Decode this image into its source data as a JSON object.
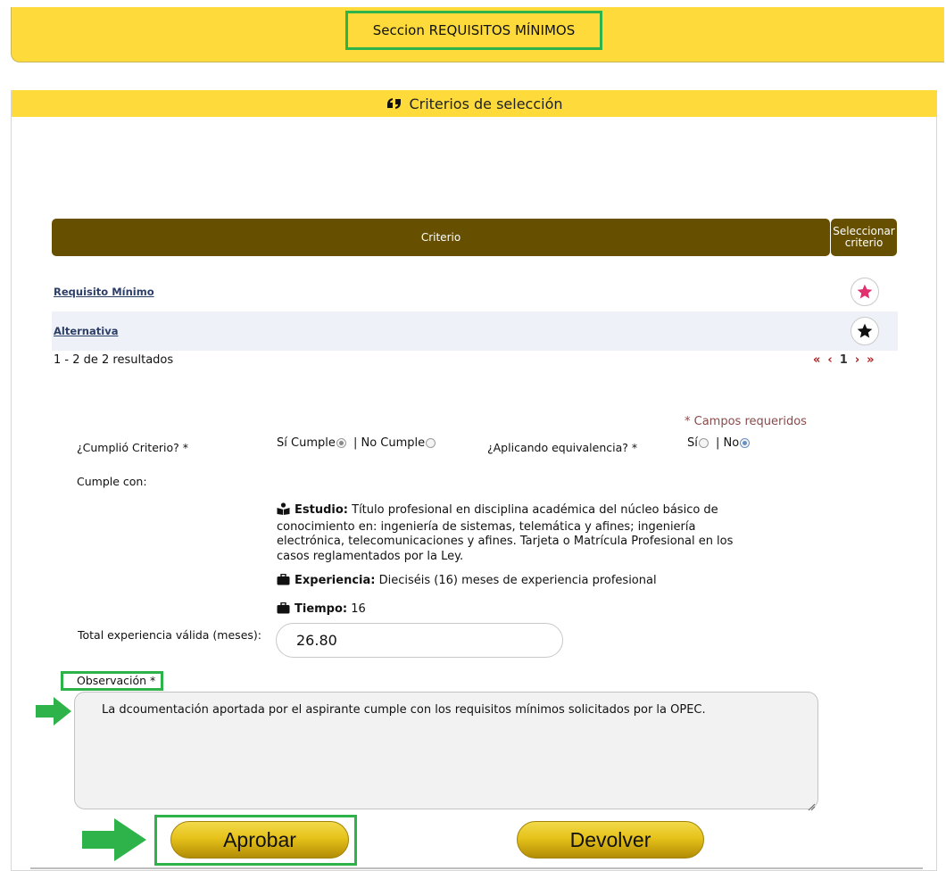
{
  "section": {
    "title": "Seccion REQUISITOS MÍNIMOS"
  },
  "criteria_panel": {
    "title": "Criterios de selección",
    "title_icon": "quote-icon"
  },
  "table": {
    "headers": [
      "Criterio",
      "Seleccionar criterio"
    ],
    "rows": [
      {
        "label": "Requisito Mínimo",
        "star_color": "#e0306e",
        "star_icon": "star-icon"
      },
      {
        "label": "Alternativa",
        "star_color": "#111111",
        "star_icon": "star-icon"
      }
    ],
    "results": "1 - 2 de 2 resultados",
    "pager": {
      "first": "«",
      "prev": "‹",
      "page": "1",
      "next": "›",
      "last": "»"
    }
  },
  "form": {
    "required_note": "* Campos requeridos",
    "cumplio_label": "¿Cumplió Criterio? *",
    "si_cumple": "Sí Cumple",
    "no_cumple": "No Cumple",
    "aplicando_label": "¿Aplicando equivalencia? *",
    "si": "Sí",
    "no": "No",
    "cumple_con_label": "Cumple con:",
    "estudio_title": "Estudio:",
    "estudio_text": "Título profesional en disciplina académica del núcleo básico de conocimiento en: ingeniería de sistemas, telemática y afines; ingeniería electrónica, telecomunicaciones y afines. Tarjeta o Matrícula Profesional en los casos reglamentados por la Ley.",
    "experiencia_title": "Experiencia:",
    "experiencia_text": "Dieciséis (16) meses de experiencia profesional",
    "tiempo_title": "Tiempo:",
    "tiempo_value": "16",
    "total_label": "Total experiencia válida (meses):",
    "total_value": "26.80",
    "observacion_label": "Observación *",
    "observacion_text": "La dcoumentación aportada por el aspirante cumple con los requisitos mínimos solicitados por la OPEC."
  },
  "buttons": {
    "aprobar": "Aprobar",
    "devolver": "Devolver"
  },
  "colors": {
    "header_yellow": "#fedb3a",
    "table_header": "#665000",
    "highlight_green": "#2db34a"
  }
}
